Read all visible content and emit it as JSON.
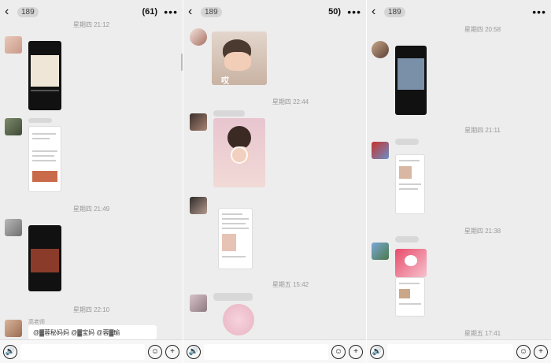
{
  "panels": [
    {
      "back_icon": "chevron-left-icon",
      "unread_count": "189",
      "title": "(61)",
      "more_icon": "more-icon",
      "timestamps": [
        "星期四 21:12",
        "星期四 21:49",
        "星期四 22:10"
      ],
      "sender_name": "高老师",
      "text_message": "@▓蓉秘妈妈 @▓宝妈 @蓉▓瑜"
    },
    {
      "back_icon": "chevron-left-icon",
      "unread_count": "189",
      "title": "50)",
      "more_icon": "more-icon",
      "timestamps": [
        "星期四 22:44",
        "星期五 15:42"
      ],
      "sticker_caption": "哎"
    },
    {
      "back_icon": "chevron-left-icon",
      "unread_count": "189",
      "title": "",
      "more_icon": "more-icon",
      "timestamps": [
        "星期四 20:58",
        "星期四 21:11",
        "星期四 21:38",
        "星期五 17:41"
      ]
    }
  ],
  "bottombar": {
    "voice_icon": "voice-icon",
    "emoji_icon": "emoji-icon",
    "plus_icon": "plus-icon",
    "voice_glyph": "🔊",
    "emoji_glyph": "☺",
    "plus_glyph": "+"
  }
}
